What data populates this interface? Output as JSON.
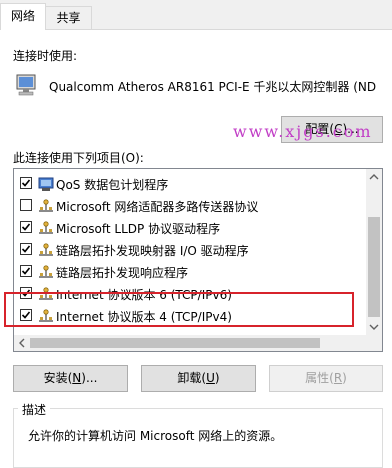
{
  "tabs": [
    {
      "label": "网络",
      "active": true
    },
    {
      "label": "共享",
      "active": false
    }
  ],
  "connect_using_label": "连接时使用:",
  "adapter_name": "Qualcomm Atheros AR8161 PCI-E 千兆以太网控制器 (ND",
  "configure_button": {
    "pre": "配置(",
    "key": "C",
    "post": ")..."
  },
  "watermark": "www.xjgs.com",
  "items_label": "此连接使用下列项目(O):",
  "items": [
    {
      "label": "QoS 数据包计划程序",
      "checked": true,
      "icon": "qos-icon"
    },
    {
      "label": "Microsoft 网络适配器多路传送器协议",
      "checked": false,
      "icon": "protocol-icon"
    },
    {
      "label": "Microsoft LLDP 协议驱动程序",
      "checked": true,
      "icon": "protocol-icon"
    },
    {
      "label": "链路层拓扑发现映射器 I/O 驱动程序",
      "checked": true,
      "icon": "protocol-icon"
    },
    {
      "label": "链路层拓扑发现响应程序",
      "checked": true,
      "icon": "protocol-icon"
    },
    {
      "label": "Internet 协议版本 6 (TCP/IPv6)",
      "checked": true,
      "icon": "protocol-icon"
    },
    {
      "label": "Internet 协议版本 4 (TCP/IPv4)",
      "checked": true,
      "icon": "protocol-icon"
    }
  ],
  "buttons": {
    "install": {
      "pre": "安装(",
      "key": "N",
      "post": ")..."
    },
    "uninstall": {
      "pre": "卸载(",
      "key": "U",
      "post": ")"
    },
    "properties": {
      "pre": "属性(",
      "key": "R",
      "post": ")"
    }
  },
  "description": {
    "title": "描述",
    "text": "允许你的计算机访问 Microsoft 网络上的资源。"
  },
  "colors": {
    "highlight_box": "#d7232b",
    "watermark": "#c13ec6"
  }
}
